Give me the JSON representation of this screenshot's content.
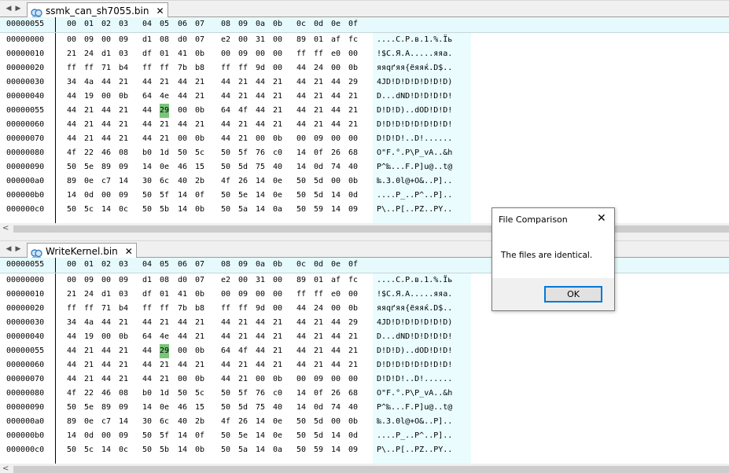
{
  "panes": [
    {
      "tab_label": "ssmk_can_sh7055.bin"
    },
    {
      "tab_label": "WriteKernel.bin"
    }
  ],
  "header_offset": "00000055",
  "column_headers": [
    "00",
    "01",
    "02",
    "03",
    "04",
    "05",
    "06",
    "07",
    "08",
    "09",
    "0a",
    "0b",
    "0c",
    "0d",
    "0e",
    "0f"
  ],
  "rows": [
    {
      "offset": "00000000",
      "bytes": [
        "00",
        "09",
        "00",
        "09",
        "d1",
        "08",
        "d0",
        "07",
        "e2",
        "00",
        "31",
        "00",
        "89",
        "01",
        "af",
        "fc"
      ],
      "ascii": "....С.Р.в.1.%.Ïь"
    },
    {
      "offset": "00000010",
      "bytes": [
        "21",
        "24",
        "d1",
        "03",
        "df",
        "01",
        "41",
        "0b",
        "00",
        "09",
        "00",
        "00",
        "ff",
        "ff",
        "e0",
        "00"
      ],
      "ascii": "!$С.Я.А.....яяа."
    },
    {
      "offset": "00000020",
      "bytes": [
        "ff",
        "ff",
        "71",
        "b4",
        "ff",
        "ff",
        "7b",
        "b8",
        "ff",
        "ff",
        "9d",
        "00",
        "44",
        "24",
        "00",
        "0b"
      ],
      "ascii": "яяqґяя{ёяяќ.D$.."
    },
    {
      "offset": "00000030",
      "bytes": [
        "34",
        "4a",
        "44",
        "21",
        "44",
        "21",
        "44",
        "21",
        "44",
        "21",
        "44",
        "21",
        "44",
        "21",
        "44",
        "29"
      ],
      "ascii": "4JD!D!D!D!D!D!D)"
    },
    {
      "offset": "00000040",
      "bytes": [
        "44",
        "19",
        "00",
        "0b",
        "64",
        "4e",
        "44",
        "21",
        "44",
        "21",
        "44",
        "21",
        "44",
        "21",
        "44",
        "21"
      ],
      "ascii": "D...dND!D!D!D!D!"
    },
    {
      "offset": "00000055",
      "bytes": [
        "44",
        "21",
        "44",
        "21",
        "44",
        "29",
        "00",
        "0b",
        "64",
        "4f",
        "44",
        "21",
        "44",
        "21",
        "44",
        "21"
      ],
      "ascii": "D!D!D)..dOD!D!D!",
      "highlight_col": 5,
      "highlight_char": 5
    },
    {
      "offset": "00000060",
      "bytes": [
        "44",
        "21",
        "44",
        "21",
        "44",
        "21",
        "44",
        "21",
        "44",
        "21",
        "44",
        "21",
        "44",
        "21",
        "44",
        "21"
      ],
      "ascii": "D!D!D!D!D!D!D!D!"
    },
    {
      "offset": "00000070",
      "bytes": [
        "44",
        "21",
        "44",
        "21",
        "44",
        "21",
        "00",
        "0b",
        "44",
        "21",
        "00",
        "0b",
        "00",
        "09",
        "00",
        "00"
      ],
      "ascii": "D!D!D!..D!......"
    },
    {
      "offset": "00000080",
      "bytes": [
        "4f",
        "22",
        "46",
        "08",
        "b0",
        "1d",
        "50",
        "5c",
        "50",
        "5f",
        "76",
        "c0",
        "14",
        "0f",
        "26",
        "68"
      ],
      "ascii": "O\"F.°.P\\P_vA..&h"
    },
    {
      "offset": "00000090",
      "bytes": [
        "50",
        "5e",
        "89",
        "09",
        "14",
        "0e",
        "46",
        "15",
        "50",
        "5d",
        "75",
        "40",
        "14",
        "0d",
        "74",
        "40"
      ],
      "ascii": "P^‰...F.P]u@..t@"
    },
    {
      "offset": "000000a0",
      "bytes": [
        "89",
        "0e",
        "c7",
        "14",
        "30",
        "6c",
        "40",
        "2b",
        "4f",
        "26",
        "14",
        "0e",
        "50",
        "5d",
        "00",
        "0b"
      ],
      "ascii": "‰.З.0l@+O&..P].."
    },
    {
      "offset": "000000b0",
      "bytes": [
        "14",
        "0d",
        "00",
        "09",
        "50",
        "5f",
        "14",
        "0f",
        "50",
        "5e",
        "14",
        "0e",
        "50",
        "5d",
        "14",
        "0d"
      ],
      "ascii": "....P_..P^..P].."
    },
    {
      "offset": "000000c0",
      "bytes": [
        "50",
        "5c",
        "14",
        "0c",
        "50",
        "5b",
        "14",
        "0b",
        "50",
        "5a",
        "14",
        "0a",
        "50",
        "59",
        "14",
        "09"
      ],
      "ascii": "P\\..P[..PZ..PY.."
    }
  ],
  "dialog": {
    "title": "File Comparison",
    "message": "The files are identical.",
    "ok_label": "OK",
    "close_glyph": "✕"
  },
  "glyphs": {
    "nav_left": "◀",
    "nav_right": "▶",
    "tab_close": "✕",
    "scroll_left": "<"
  },
  "icons": {
    "tab_file": "file-compare-icon",
    "tab_close": "close-icon",
    "dialog_close": "close-icon"
  },
  "colors": {
    "header_bg": "#e6fafd",
    "ascii_bg": "#eafcfe",
    "highlight": "#7ac47a",
    "focus_border": "#0078d7"
  }
}
